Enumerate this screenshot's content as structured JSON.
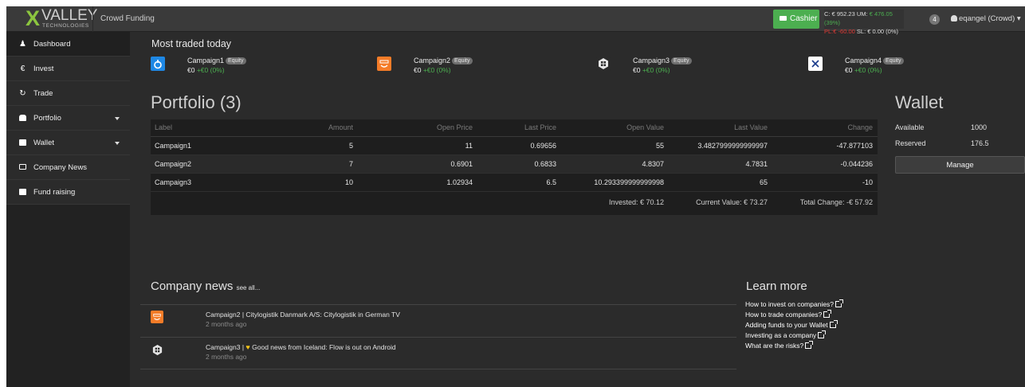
{
  "topbar": {
    "logo_text": "VALLEY",
    "logo_sub": "TECHNOLOGIES",
    "logo_mark": "X",
    "brand_title": "Crowd Funding",
    "cashier_label": "Cashier",
    "balance_line1": "C: € 952.23 UM:",
    "balance_line1_extra": "€ 476.05 (39%)",
    "balance_line2_pl": "PL:",
    "balance_line2_pl_val": "€ -60.00",
    "balance_line2_sl": "SL: € 0.00 (0%)",
    "notification_count": "4",
    "user_label": "eqangel (Crowd)"
  },
  "sidebar": {
    "items": [
      {
        "label": "Dashboard",
        "icon": "user-icon",
        "caret": false,
        "active": true
      },
      {
        "label": "Invest",
        "icon": "euro-icon",
        "caret": false,
        "active": false
      },
      {
        "label": "Trade",
        "icon": "refresh-icon",
        "caret": false,
        "active": false
      },
      {
        "label": "Portfolio",
        "icon": "briefcase-icon",
        "caret": true,
        "active": false
      },
      {
        "label": "Wallet",
        "icon": "wallet-icon",
        "caret": true,
        "active": false
      },
      {
        "label": "Company News",
        "icon": "newspaper-icon",
        "caret": false,
        "active": false
      },
      {
        "label": "Fund raising",
        "icon": "money-icon",
        "caret": false,
        "active": false
      }
    ]
  },
  "most_traded": {
    "title": "Most traded today",
    "items": [
      {
        "name": "Campaign1",
        "badge": "Equity",
        "price": "€0",
        "change": "+€0 (0%)",
        "icon_color": "#1e88e5"
      },
      {
        "name": "Campaign2",
        "badge": "Equity",
        "price": "€0",
        "change": "+€0 (0%)",
        "icon_color": "#f57c28"
      },
      {
        "name": "Campaign3",
        "badge": "Equity",
        "price": "€0",
        "change": "+€0 (0%)",
        "icon_color": "#2b2b2b"
      },
      {
        "name": "Campaign4",
        "badge": "Equity",
        "price": "€0",
        "change": "+€0 (0%)",
        "icon_color": "#ffffff"
      }
    ]
  },
  "portfolio": {
    "title": "Portfolio (3)",
    "columns": [
      "Label",
      "Amount",
      "Open Price",
      "Last Price",
      "Open Value",
      "Last Value",
      "Change"
    ],
    "rows": [
      [
        "Campaign1",
        "5",
        "11",
        "0.69656",
        "55",
        "3.4827999999999997",
        "-47.877103"
      ],
      [
        "Campaign2",
        "7",
        "0.6901",
        "0.6833",
        "4.8307",
        "4.7831",
        "-0.044236"
      ],
      [
        "Campaign3",
        "10",
        "1.02934",
        "6.5",
        "10.293399999999998",
        "65",
        "-10"
      ]
    ],
    "invested": "Invested: € 70.12",
    "current_value": "Current Value: € 73.27",
    "total_change": "Total Change: -€ 57.92"
  },
  "wallet": {
    "title": "Wallet",
    "available_label": "Available",
    "available_value": "1000",
    "reserved_label": "Reserved",
    "reserved_value": "176.5",
    "manage_label": "Manage"
  },
  "news": {
    "title": "Company news",
    "see_all": "see all...",
    "items": [
      {
        "prefix": "Campaign2 | Citylogistik Danmark A/S: Citylogistik in German TV",
        "heart": false,
        "text": "",
        "time": "2 months ago"
      },
      {
        "prefix": "Campaign3 |",
        "heart": true,
        "text": "Good news from Iceland: Flow is out on Android",
        "time": "2 months ago"
      }
    ]
  },
  "learn": {
    "title": "Learn more",
    "links": [
      "How to invest on companies?",
      "How to trade companies?",
      "Adding funds to your Wallet",
      "Investing as a company",
      "What are the risks?"
    ]
  }
}
